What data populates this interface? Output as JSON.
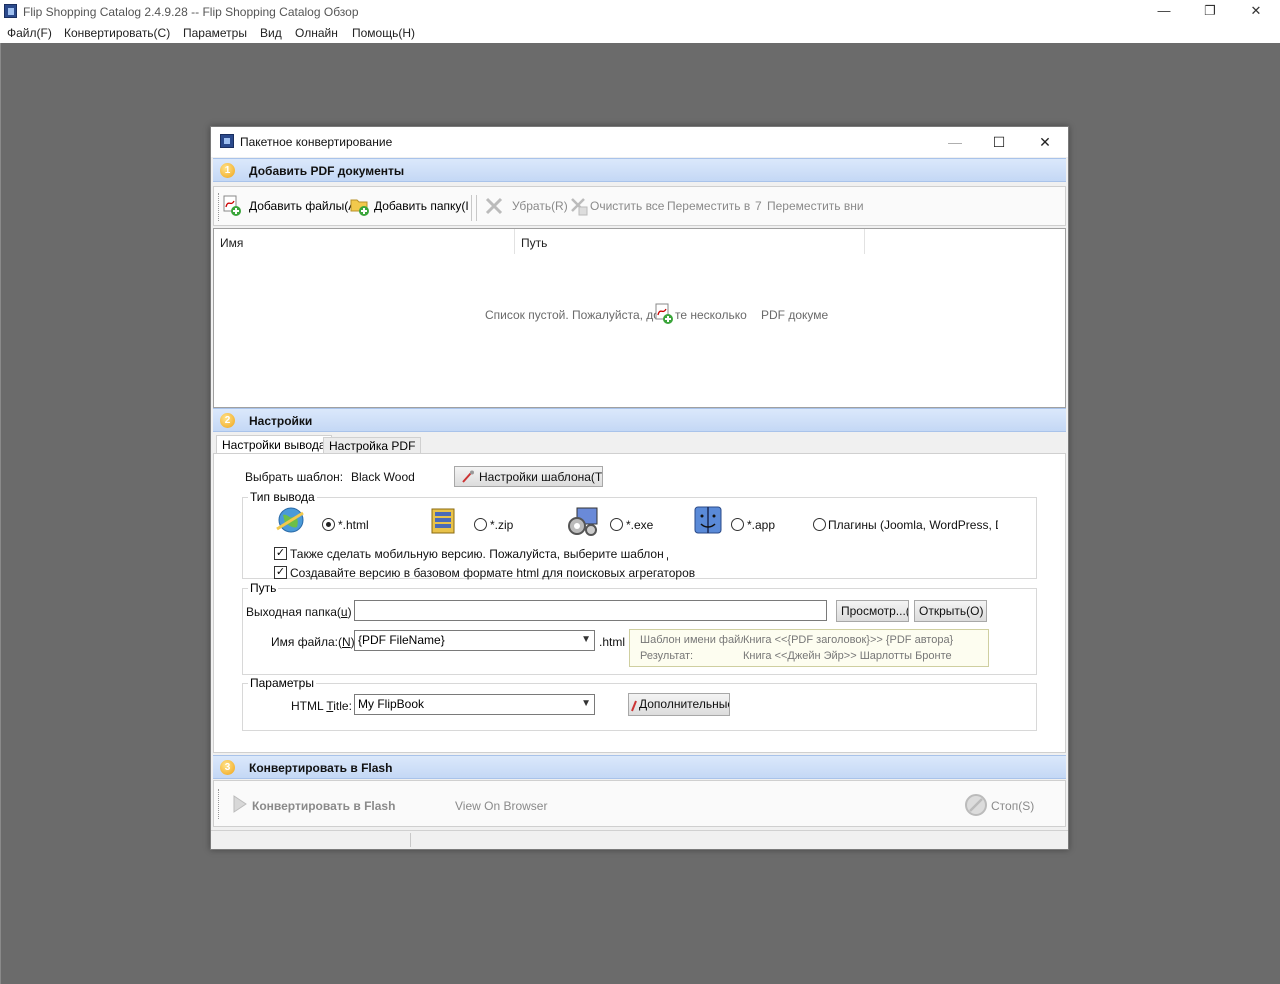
{
  "app": {
    "title": "Flip Shopping Catalog 2.4.9.28 -- Flip Shopping Catalog Обзор",
    "minimize": "—",
    "restore": "❐",
    "close": "✕"
  },
  "menu": [
    "Файл(F)",
    "Конвертировать(C)",
    "Параметры",
    "Вид",
    "Олнайн",
    "Помощь(H)"
  ],
  "dialog": {
    "title": "Пакетное конвертирование",
    "minimize": "—",
    "maximize": "☐",
    "close": "✕"
  },
  "section1": {
    "number": "1",
    "title": "Добавить PDF документы",
    "toolbar": {
      "add_files": "Добавить файлы(А",
      "add_folder": "Добавить папку(I",
      "remove": "Убрать(R)",
      "clear_all": "Очистить все",
      "move_up": "Переместить вв",
      "move_up_key": "7",
      "move_down": "Переместить вни"
    },
    "columns": [
      "Имя",
      "Путь"
    ],
    "empty_text_left": "Список пустой. Пожалуйста, доб",
    "empty_text_mid": "те несколько",
    "empty_text_right": "PDF докуме"
  },
  "section2": {
    "number": "2",
    "title": "Настройки",
    "tabs": [
      "Настройки вывода",
      "Настройка PDF"
    ],
    "template_label": "Выбрать шаблон:",
    "template_value": "Black Wood",
    "template_settings_button": "Настройки шаблона(T)",
    "output_type_title": "Тип вывода",
    "output_types": [
      {
        "label": "*.html",
        "icon": "globe-icon",
        "checked": true
      },
      {
        "label": "*.zip",
        "icon": "archive-icon",
        "checked": false
      },
      {
        "label": "*.exe",
        "icon": "gears-icon",
        "checked": false
      },
      {
        "label": "*.app",
        "icon": "mac-finder-icon",
        "checked": false
      },
      {
        "label": "Плагины (Joomla, WordPress, Dru",
        "icon": "",
        "checked": false
      }
    ],
    "mobile_version": "Также сделать мобильную версию. Пожалуйста, выберите шаблон для м",
    "basic_html": "Создавайте версию в базовом формате html для поисковых агрегаторов",
    "path_title": "Путь",
    "output_folder_label": "Выходная папка(",
    "output_folder_key": "u",
    "output_folder_close": ")",
    "output_folder_value": "",
    "browse_button": "Просмотр...(В)",
    "open_button": "Открыть(O)",
    "filename_label": "Имя файла:(",
    "filename_key": "N",
    "filename_close": ")",
    "filename_value": "{PDF FileName}",
    "filename_ext": ".html",
    "hint_template_label": "Шаблон имени файла",
    "hint_template_value": "Книга <<{PDF заголовок}>> {PDF автора}",
    "hint_result_label": "Результат:",
    "hint_result_value": "Книга <<Джейн Эйр>> Шарлотты Бронте",
    "params_title": "Параметры",
    "html_title_label_a": "HTML ",
    "html_title_label_key": "T",
    "html_title_label_b": "itle:",
    "html_title_value": "My FlipBook",
    "advanced_button": "Дополнительные("
  },
  "section3": {
    "number": "3",
    "title": "Конвертировать в Flash",
    "convert_button": "Конвертировать в Flash",
    "view_browser": "View On Browser",
    "stop_button": "Стоп(S)"
  }
}
